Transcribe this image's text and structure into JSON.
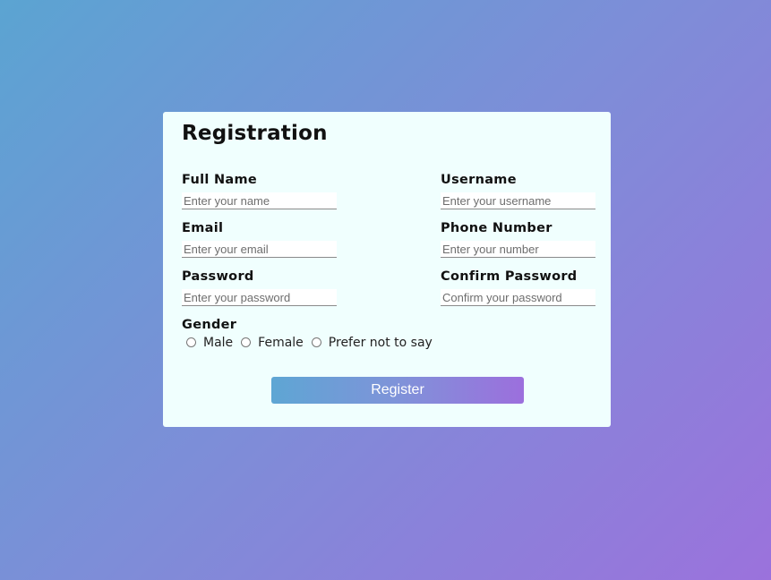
{
  "form": {
    "title": "Registration",
    "fields": {
      "full_name": {
        "label": "Full Name",
        "placeholder": "Enter your name",
        "value": ""
      },
      "username": {
        "label": "Username",
        "placeholder": "Enter your username",
        "value": ""
      },
      "email": {
        "label": "Email",
        "placeholder": "Enter your email",
        "value": ""
      },
      "phone": {
        "label": "Phone Number",
        "placeholder": "Enter your number",
        "value": ""
      },
      "password": {
        "label": "Password",
        "placeholder": "Enter your password",
        "value": ""
      },
      "confirm_password": {
        "label": "Confirm Password",
        "placeholder": "Confirm your password",
        "value": ""
      }
    },
    "gender": {
      "label": "Gender",
      "options": [
        "Male",
        "Female",
        "Prefer not to say"
      ],
      "selected": null
    },
    "submit_label": "Register"
  },
  "colors": {
    "background_start": "#5ba4d2",
    "background_end": "#9b72dc",
    "card_background": "#f0fffe",
    "button_gradient_start": "#5ea6d4",
    "button_gradient_end": "#9c6fdd",
    "button_text": "#ffffff"
  }
}
